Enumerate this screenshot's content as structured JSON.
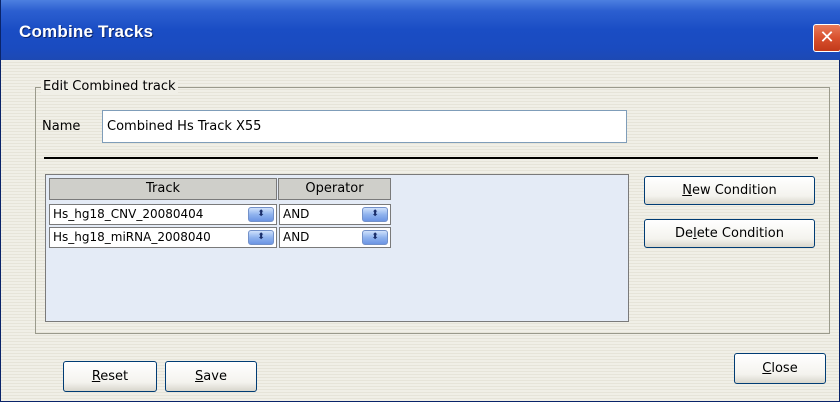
{
  "window": {
    "title": "Combine Tracks",
    "close_glyph": "✕"
  },
  "group": {
    "legend": "Edit Combined track"
  },
  "name_field": {
    "label": "Name",
    "value": "Combined Hs Track X55"
  },
  "table": {
    "headers": [
      "Track",
      "Operator"
    ],
    "rows": [
      {
        "track": "Hs_hg18_CNV_20080404",
        "operator": "AND"
      },
      {
        "track": "Hs_hg18_miRNA_2008040",
        "operator": "AND"
      }
    ],
    "spinner_glyph": "⬍"
  },
  "buttons": {
    "new_condition": {
      "mnemonic": "N",
      "rest": "ew Condition"
    },
    "delete_condition": {
      "pre": "De",
      "mnemonic": "l",
      "rest": "ete Condition"
    },
    "reset": {
      "mnemonic": "R",
      "rest": "eset"
    },
    "save": {
      "mnemonic": "S",
      "rest": "ave"
    },
    "close": {
      "mnemonic": "C",
      "rest": "lose"
    }
  },
  "colors": {
    "titlebar": "#2c5fd0",
    "close_button": "#d9512e",
    "table_background": "#e4ebf6",
    "spinner": "#8fb3ee"
  }
}
